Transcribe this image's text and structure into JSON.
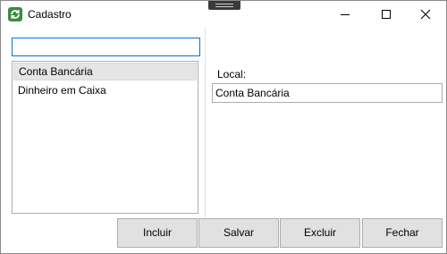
{
  "window": {
    "title": "Cadastro",
    "icon": "refresh-icon",
    "controls": [
      "minimize-icon",
      "maximize-icon",
      "close-icon"
    ]
  },
  "search": {
    "value": "",
    "placeholder": ""
  },
  "list": {
    "items": [
      {
        "label": "Conta Bancária",
        "selected": true
      },
      {
        "label": "Dinheiro em Caixa",
        "selected": false
      }
    ]
  },
  "detail": {
    "local_label": "Local:",
    "local_value": "Conta Bancária"
  },
  "buttons": {
    "incluir": "Incluir",
    "salvar": "Salvar",
    "excluir": "Excluir",
    "fechar": "Fechar"
  },
  "colors": {
    "focus_border": "#0078d7",
    "selection_bg": "#e5e5e5",
    "button_bg": "#e1e1e1",
    "icon_green": "#3c8c3c"
  }
}
